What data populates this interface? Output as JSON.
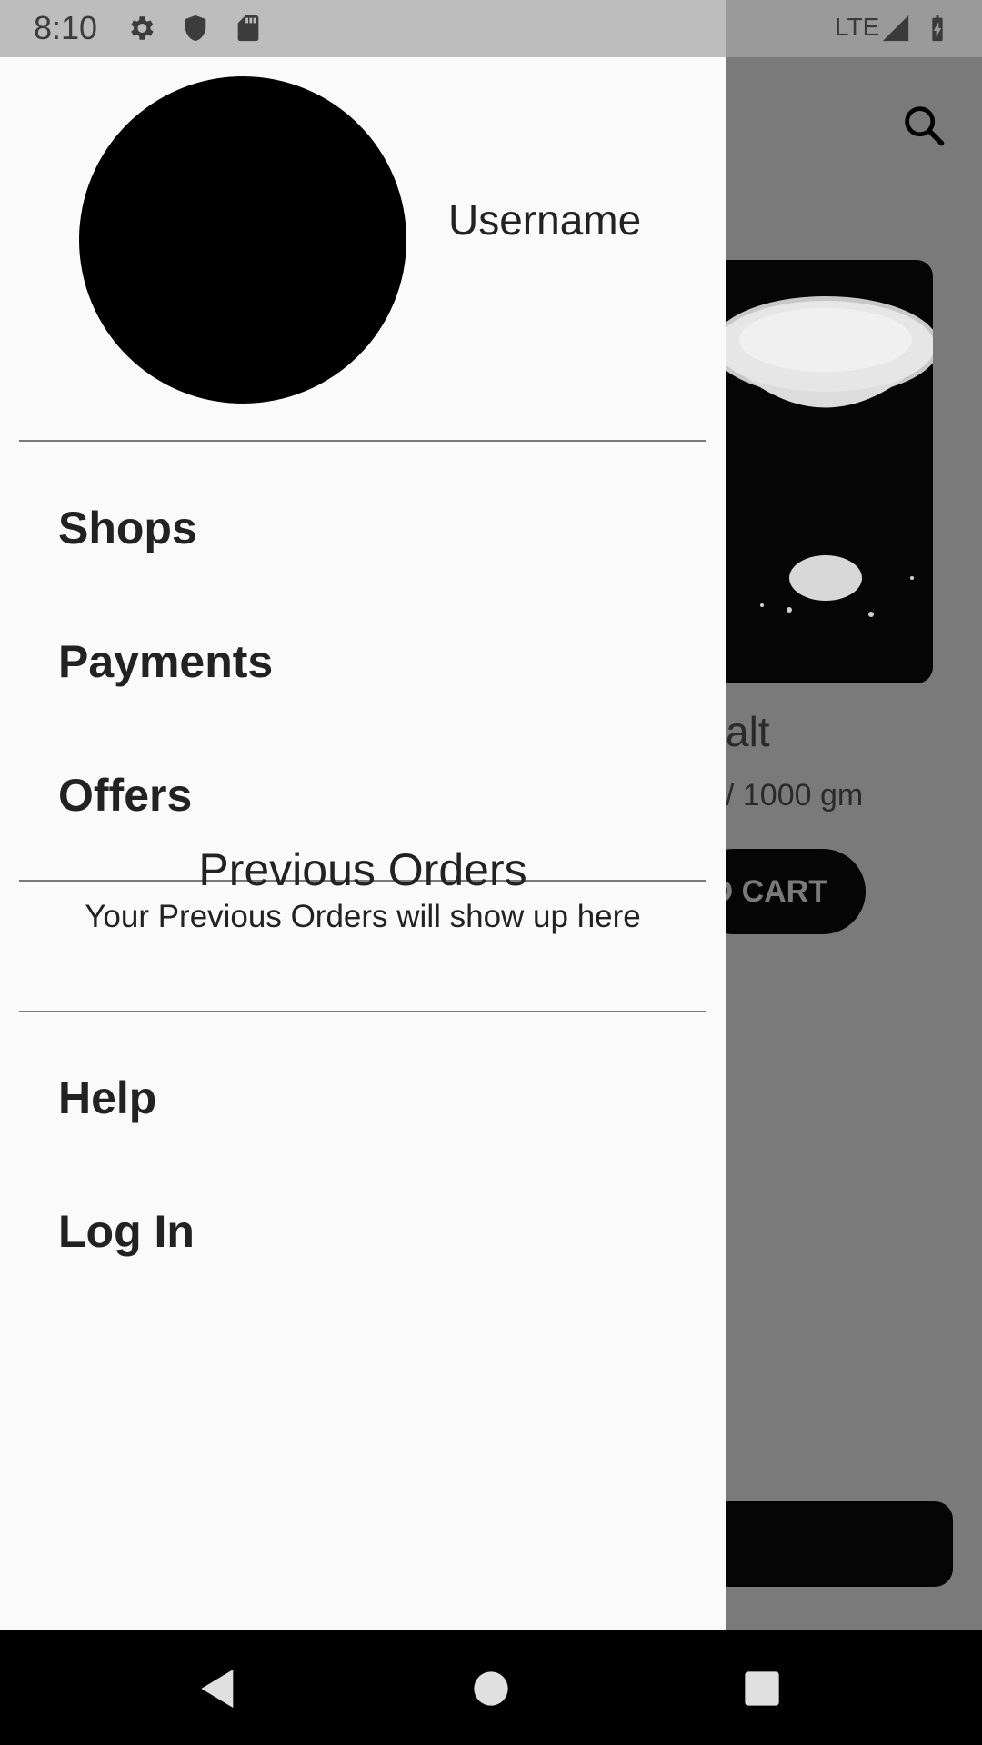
{
  "status_bar": {
    "time": "8:10",
    "network": "LTE",
    "icons": [
      "gear-icon",
      "shield-icon",
      "sd-card-icon",
      "signal-icon",
      "battery-charging-icon"
    ]
  },
  "drawer": {
    "username": "Username",
    "menu_top": [
      {
        "label": "Shops"
      },
      {
        "label": "Payments"
      },
      {
        "label": "Offers"
      }
    ],
    "previous_orders": {
      "title": "Previous Orders",
      "subtitle": "Your Previous Orders will show up here"
    },
    "menu_bottom": [
      {
        "label": "Help"
      },
      {
        "label": "Log In"
      }
    ]
  },
  "background": {
    "product_name": "alt",
    "product_qty": "/ 1000 gm",
    "cart_label": "D CART"
  },
  "nav_bar": {
    "icons": [
      "back-icon",
      "home-icon",
      "recents-icon"
    ]
  }
}
